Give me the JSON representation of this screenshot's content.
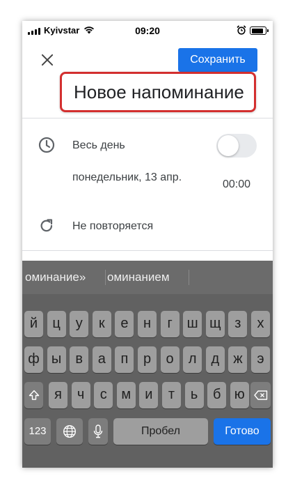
{
  "status_bar": {
    "carrier": "Kyivstar",
    "time": "09:20",
    "battery_level": 0.85
  },
  "header": {
    "save_label": "Сохранить",
    "close_icon": "close-icon"
  },
  "title": {
    "text": "Новое напоминание"
  },
  "event": {
    "all_day_label": "Весь день",
    "all_day_enabled": false,
    "date": "понедельник, 13 апр.",
    "time": "00:00",
    "repeat_label": "Не повторяется"
  },
  "keyboard": {
    "suggestions": [
      "оминание»",
      "оминанием"
    ],
    "row1": [
      "й",
      "ц",
      "у",
      "к",
      "е",
      "н",
      "г",
      "ш",
      "щ",
      "з",
      "х"
    ],
    "row2": [
      "ф",
      "ы",
      "в",
      "а",
      "п",
      "р",
      "о",
      "л",
      "д",
      "ж",
      "э"
    ],
    "row3": [
      "я",
      "ч",
      "с",
      "м",
      "и",
      "т",
      "ь",
      "б",
      "ю"
    ],
    "numbers_label": "123",
    "space_label": "Пробел",
    "done_label": "Готово",
    "icons": [
      "shift-icon",
      "backspace-icon",
      "globe-icon",
      "microphone-icon"
    ]
  },
  "colors": {
    "accent": "#1a73e8",
    "highlight": "#d32f2f",
    "keyboard_bg": "#616161"
  }
}
